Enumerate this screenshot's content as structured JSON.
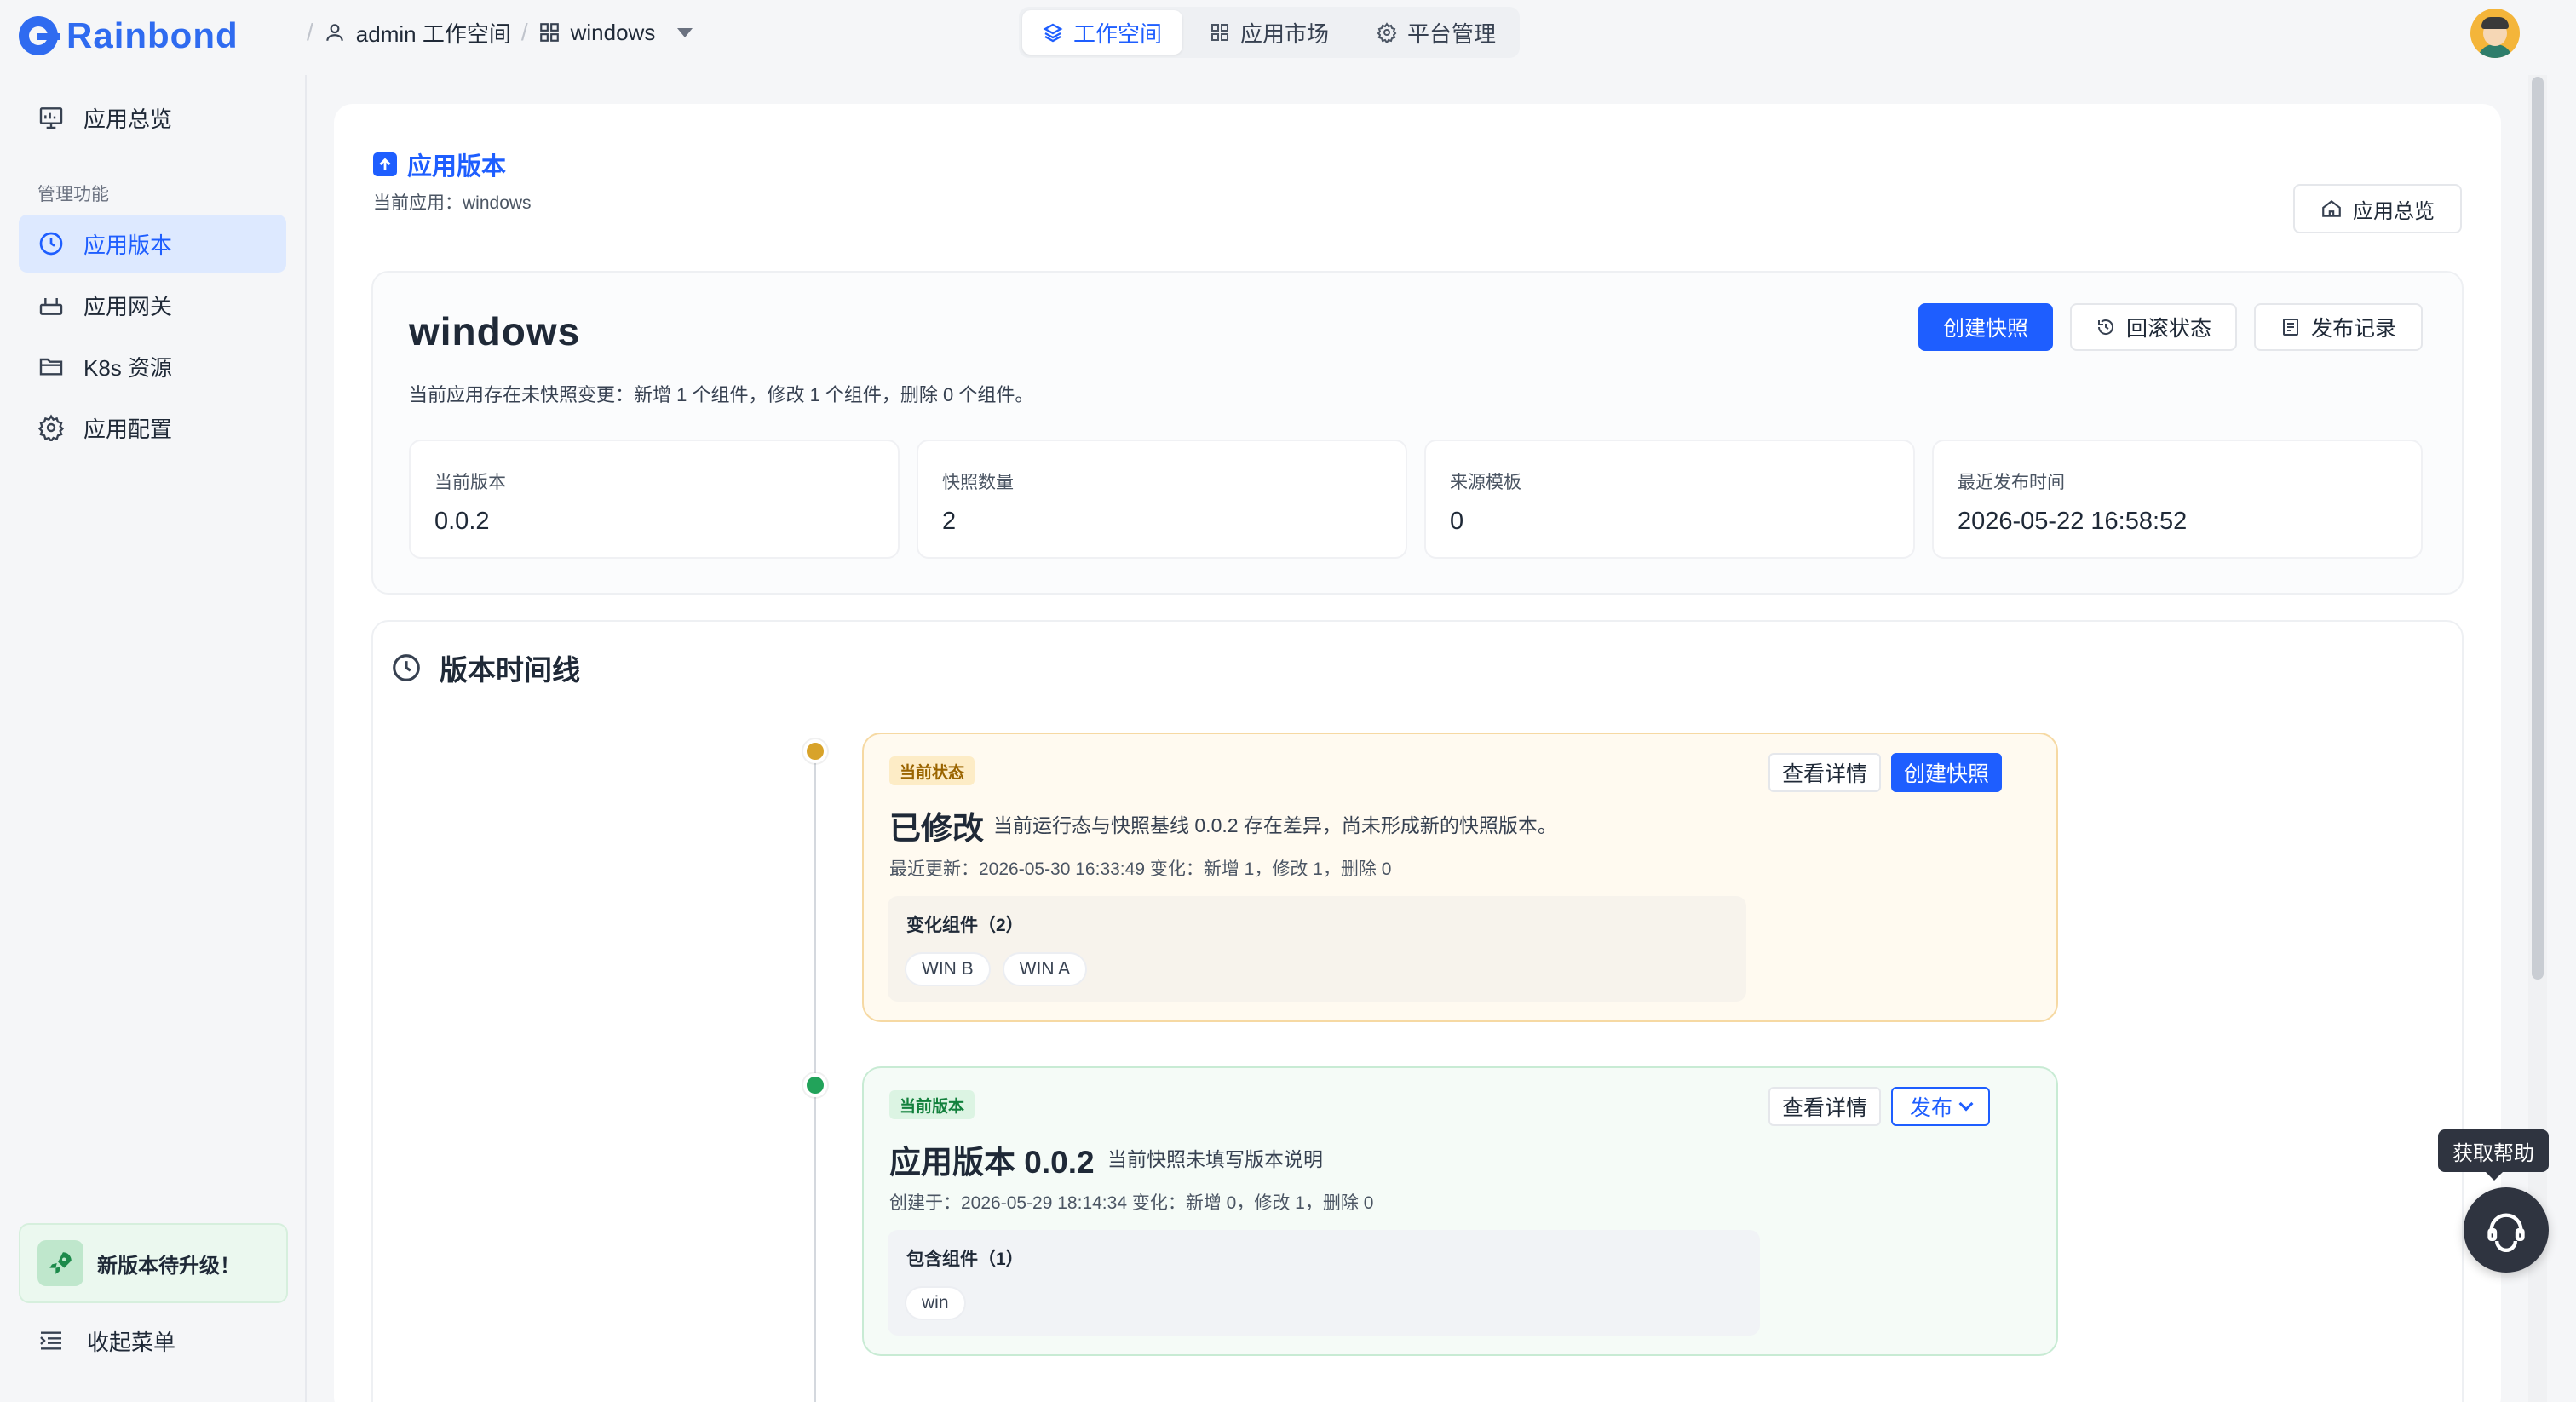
{
  "brand": {
    "name": "Rainbond"
  },
  "breadcrumb": {
    "team": "admin 工作空间",
    "app": "windows"
  },
  "topnav": {
    "tabs": [
      {
        "label": "工作空间",
        "active": true
      },
      {
        "label": "应用市场",
        "active": false
      },
      {
        "label": "平台管理",
        "active": false
      }
    ]
  },
  "sidebar": {
    "overview": "应用总览",
    "section_title": "管理功能",
    "items": [
      {
        "label": "应用版本",
        "active": true
      },
      {
        "label": "应用网关",
        "active": false
      },
      {
        "label": "K8s 资源",
        "active": false
      },
      {
        "label": "应用配置",
        "active": false
      }
    ],
    "upgrade": "新版本待升级！",
    "collapse": "收起菜单"
  },
  "page": {
    "title": "应用版本",
    "subtitle": "当前应用：windows",
    "overview_button": "应用总览"
  },
  "summary": {
    "app_name": "windows",
    "description": "当前应用存在未快照变更：新增 1 个组件，修改 1 个组件，删除 0 个组件。",
    "actions": {
      "create_snapshot": "创建快照",
      "rollback": "回滚状态",
      "publish_log": "发布记录"
    },
    "stats": [
      {
        "label": "当前版本",
        "value": "0.0.2"
      },
      {
        "label": "快照数量",
        "value": "2"
      },
      {
        "label": "来源模板",
        "value": "0"
      },
      {
        "label": "最近发布时间",
        "value": "2026-05-22 16:58:52"
      }
    ]
  },
  "timeline": {
    "title": "版本时间线",
    "events": [
      {
        "badge": "当前状态",
        "title": "已修改",
        "note": "当前运行态与快照基线 0.0.2 存在差异，尚未形成新的快照版本。",
        "meta": "最近更新：2026-05-30 16:33:49    变化：新增 1，修改 1，删除 0",
        "btn_detail": "查看详情",
        "btn_primary": "创建快照",
        "components_title": "变化组件（2）",
        "components": [
          "WIN B",
          "WIN A"
        ],
        "dot_color": "#d8a32a"
      },
      {
        "badge": "当前版本",
        "title": "应用版本 0.0.2",
        "note": "当前快照未填写版本说明",
        "meta": "创建于：2026-05-29 18:14:34    变化：新增 0，修改 1，删除 0",
        "btn_detail": "查看详情",
        "btn_primary": "发布",
        "components_title": "包含组件（1）",
        "components": [
          "win"
        ],
        "dot_color": "#22a35a"
      }
    ]
  },
  "help": {
    "tooltip": "获取帮助"
  }
}
